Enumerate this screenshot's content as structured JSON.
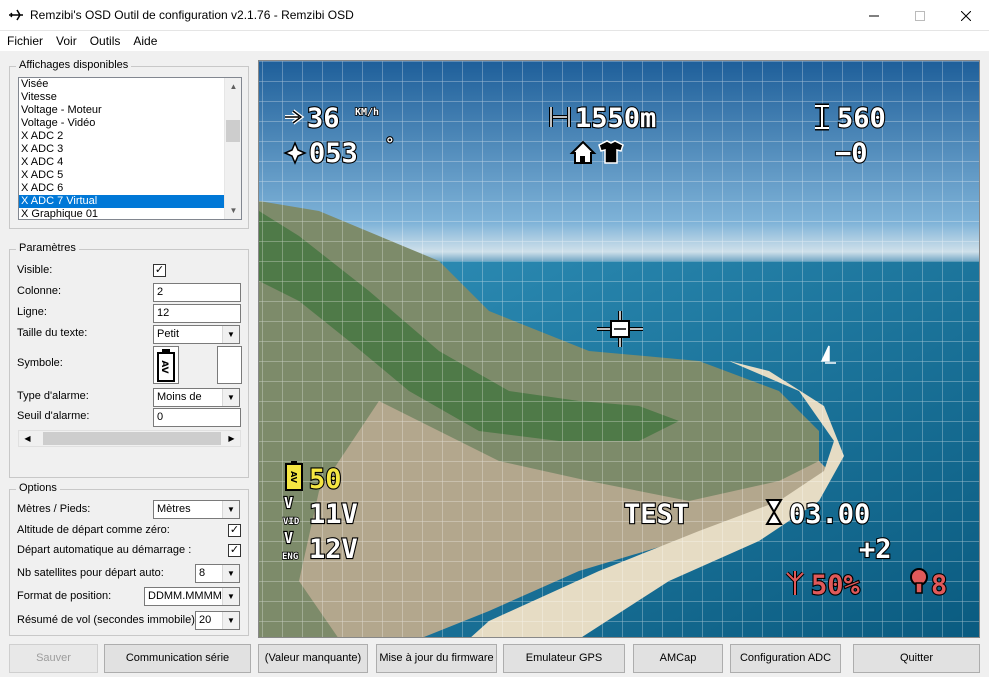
{
  "window": {
    "title": "Remzibi's OSD Outil de configuration v2.1.76 - Remzibi OSD"
  },
  "menu": [
    "Fichier",
    "Voir",
    "Outils",
    "Aide"
  ],
  "displays_group": {
    "legend": "Affichages disponibles",
    "items": [
      "Visée",
      "Vitesse",
      "Voltage - Moteur",
      "Voltage - Vidéo",
      "X ADC 2",
      "X ADC 3",
      "X ADC 4",
      "X ADC 5",
      "X ADC 6",
      "X ADC 7 Virtual",
      "X Graphique 01"
    ],
    "selected_index": 9
  },
  "params_group": {
    "legend": "Paramètres",
    "visible_label": "Visible:",
    "visible_checked": "✓",
    "column_label": "Colonne:",
    "column_value": "2",
    "row_label": "Ligne:",
    "row_value": "12",
    "text_size_label": "Taille du texte:",
    "text_size_value": "Petit",
    "symbol_label": "Symbole:",
    "symbol_glyph": "AV",
    "alarm_type_label": "Type d'alarme:",
    "alarm_type_value": "Moins de",
    "alarm_threshold_label": "Seuil d'alarme:",
    "alarm_threshold_value": "0"
  },
  "options_group": {
    "legend": "Options",
    "units_label": "Mètres / Pieds:",
    "units_value": "Mètres",
    "alt_zero_label": "Altitude de départ comme zéro:",
    "alt_zero_checked": "✓",
    "auto_start_label": "Départ automatique au démarrage :",
    "auto_start_checked": "✓",
    "sats_label": "Nb satellites pour départ auto:",
    "sats_value": "8",
    "pos_format_label": "Format de position:",
    "pos_format_value": "DDMM.MMMM",
    "flight_summary_label": "Résumé de vol (secondes immobile):",
    "flight_summary_value": "20"
  },
  "osd": {
    "speed": "36",
    "speed_unit": "KM/h",
    "distance": "1550m",
    "altitude": "560",
    "heading": "053",
    "degree": "°",
    "vario": "−0",
    "adc_value": "50",
    "adc_symbol": "AV",
    "vid_label": "VID",
    "vid_value": "11V",
    "eng_label": "ENG",
    "eng_value": "12V",
    "test": "TEST",
    "timer": "03.00",
    "sats_delta": "+2",
    "rssi": "50%",
    "sats": "8"
  },
  "buttons": {
    "save": "Sauver",
    "serial": "Communication série",
    "missing": "(Valeur manquante)",
    "firmware": "Mise à jour du firmware",
    "gps_emu": "Emulateur GPS",
    "amcap": "AMCap",
    "adc_config": "Configuration ADC",
    "quit": "Quitter"
  },
  "colors": {
    "selection": "#0078d7",
    "osd_alarm_yellow": "#f5e642",
    "osd_alarm_red": "#e05a5a"
  }
}
